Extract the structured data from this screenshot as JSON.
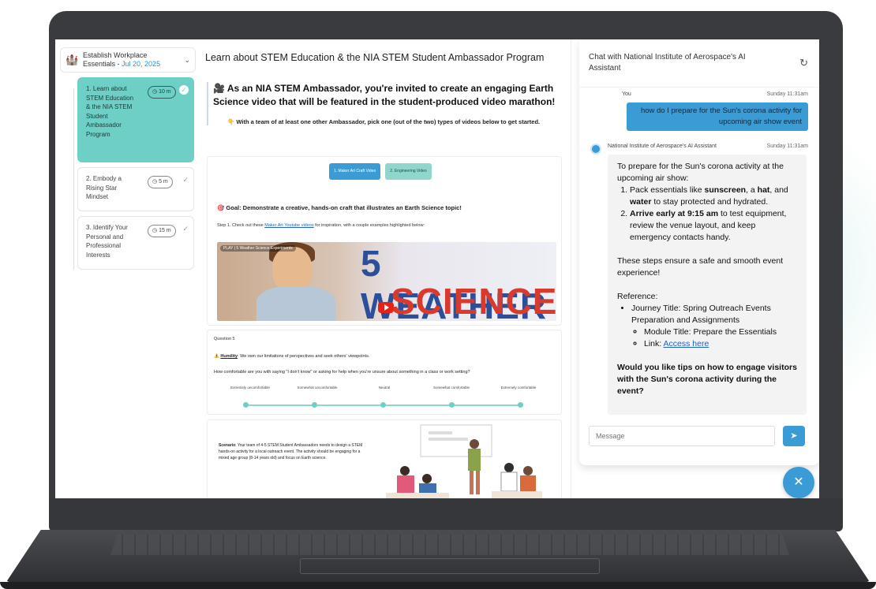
{
  "sidebar": {
    "journey_title": "Establish Workplace Essentials",
    "journey_date": "Jul 20, 2025",
    "journey_sep": " - ",
    "modules": [
      {
        "label": "1. Learn about STEM Education & the NIA STEM Student Ambassador Program",
        "time": "10 m",
        "active": true
      },
      {
        "label": "2. Embody a Rising Star Mindset",
        "time": "5 m",
        "active": false
      },
      {
        "label": "3. Identify Your Personal and Professional Interests",
        "time": "15 m",
        "active": false
      }
    ]
  },
  "main": {
    "title": "Learn about STEM Education & the NIA STEM Student Ambassador Program",
    "intro_heading": "🎥 As an NIA STEM Ambassador, you're invited to create an engaging Earth Science video that will be featured in the student-produced video marathon!",
    "intro_note": "👇 With a team of at least one other Ambassador, pick one (out of the two) types of videos below to get started.",
    "tabs": [
      "1. Maker Art Craft Video",
      "2. Engineering Video"
    ],
    "goal": "🎯 Goal: Demonstrate a creative, hands-on craft that illustrates an Earth Science topic!",
    "step_prefix": "Step 1. Check out these ",
    "step_link": "Maker Art Youtube videos",
    "step_suffix": " for inspiration, with a couple examples highlighted below:",
    "video": {
      "overlay": "PLAY | 5 Weather Science Experiments",
      "line1": "5 WEATHER",
      "line2": "SCIENCE"
    },
    "question": {
      "label": "Question 5",
      "trait": "Humility",
      "trait_text": ": We own our limitations of perspectives and seek others' viewpoints.",
      "text": "How comfortable are you with saying \"I don't know\" or asking for help when you're unsure about something in a class or work setting?",
      "scale": [
        "Extremely uncomfortable",
        "Somewhat uncomfortable",
        "Neutral",
        "Somewhat comfortable",
        "Extremely comfortable"
      ]
    },
    "scenario": {
      "label": "Scenario",
      "text": ": Your team of 4-5 STEM Student Ambassadors needs to design a STEM hands-on activity for a local outreach event. The activity should be engaging for a mixed age group (8-14 years old) and focus on Earth science."
    }
  },
  "chat": {
    "title": "Chat with National Institute of Aerospace's AI Assistant",
    "user_name": "You",
    "user_time": "Sunday 11:31am",
    "user_message": "how do I prepare for the Sun's corona activity for upcoming air show event",
    "ai_name": "National Institute of Aerospace's AI Assistant",
    "ai_time": "Sunday 11:31am",
    "ai_intro": "To prepare for the Sun's corona activity at the upcoming air show:",
    "ai_item1_a": "Pack essentials like ",
    "ai_item1_b": "sunscreen",
    "ai_item1_c": ", a ",
    "ai_item1_d": "hat",
    "ai_item1_e": ", and ",
    "ai_item1_f": "water",
    "ai_item1_g": " to stay protected and hydrated.",
    "ai_item2_a": "Arrive early at 9:15 am",
    "ai_item2_b": " to test equipment, review the venue layout, and keep emergency contacts handy.",
    "ai_para2": "These steps ensure a safe and smooth event experience!",
    "ai_ref_label": "Reference:",
    "ai_ref_journey": "Journey Title: Spring Outreach Events Preparation and Assignments",
    "ai_ref_module": "Module Title: Prepare the Essentials",
    "ai_ref_link_label": "Link: ",
    "ai_ref_link": "Access here",
    "ai_closing": "Would you like tips on how to engage visitors with the Sun's corona activity during the event?",
    "input_placeholder": "Message"
  },
  "colors": {
    "accent_teal": "#6ecfc6",
    "accent_blue": "#3b9bd4",
    "laptop": "#3a3b3e"
  }
}
